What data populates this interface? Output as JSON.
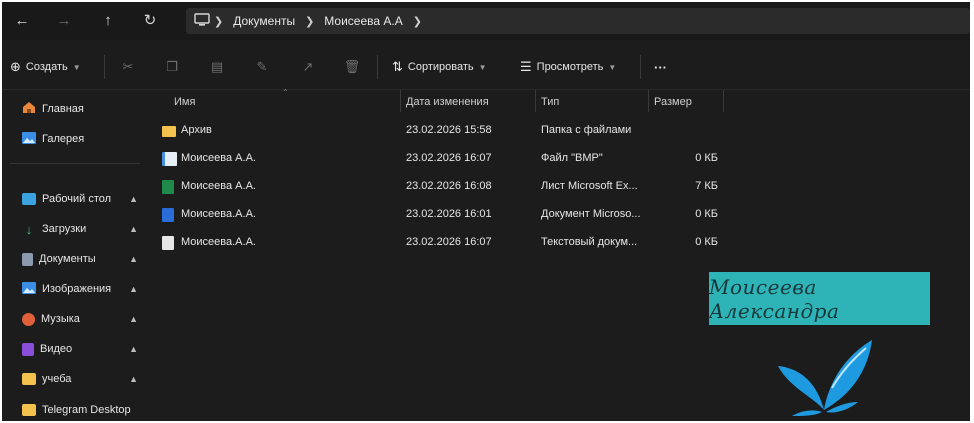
{
  "nav": {
    "back_icon": "arrow-left-icon",
    "forward_icon": "arrow-right-icon",
    "up_icon": "arrow-up-icon",
    "refresh_icon": "refresh-icon"
  },
  "breadcrumb": {
    "root_icon": "computer-icon",
    "items": [
      "Документы",
      "Моисеева А.А"
    ]
  },
  "toolbar": {
    "create": "Создать",
    "sort": "Сортировать",
    "view": "Просмотреть",
    "more": "···"
  },
  "sidebar": {
    "pinned": [
      {
        "label": "Главная",
        "icon": "home-icon",
        "color": "#e8873a"
      },
      {
        "label": "Галерея",
        "icon": "gallery-icon",
        "color": "#3a8ee6"
      }
    ],
    "quick": [
      {
        "label": "Рабочий стол",
        "icon": "desktop-icon",
        "color": "#3ba4e0",
        "pin": "📌"
      },
      {
        "label": "Загрузки",
        "icon": "download-icon",
        "color": "#3fbf7a",
        "pin": "📌"
      },
      {
        "label": "Документы",
        "icon": "documents-icon",
        "color": "#8c9ab0",
        "pin": "📌"
      },
      {
        "label": "Изображения",
        "icon": "pictures-icon",
        "color": "#3a8ee6",
        "pin": "📌"
      },
      {
        "label": "Музыка",
        "icon": "music-icon",
        "color": "#e0603a",
        "pin": "📌"
      },
      {
        "label": "Видео",
        "icon": "video-icon",
        "color": "#8a4fd8",
        "pin": "📌"
      },
      {
        "label": "учеба",
        "icon": "folder-icon",
        "color": "#f2c14e",
        "pin": "📌"
      },
      {
        "label": "Telegram Desktop",
        "icon": "folder-icon",
        "color": "#f2c14e",
        "pin": ""
      }
    ]
  },
  "columns": {
    "name": "Имя",
    "date": "Дата изменения",
    "type": "Тип",
    "size": "Размер"
  },
  "files": [
    {
      "name": "Архив",
      "date": "23.02.2026 15:58",
      "type": "Папка с файлами",
      "size": "",
      "icon": "folder-icon",
      "color": "#f2c14e"
    },
    {
      "name": "Моисеева А.А.",
      "date": "23.02.2026 16:07",
      "type": "Файл \"BMP\"",
      "size": "0 КБ",
      "icon": "image-file-icon",
      "color": "#4b8fe0"
    },
    {
      "name": "Моисеева А.А.",
      "date": "23.02.2026 16:08",
      "type": "Лист Microsoft Ex...",
      "size": "7 КБ",
      "icon": "excel-file-icon",
      "color": "#1f8a4c"
    },
    {
      "name": "Моисеева.А.А.",
      "date": "23.02.2026 16:01",
      "type": "Документ Microso...",
      "size": "0 КБ",
      "icon": "word-file-icon",
      "color": "#2b6cd6"
    },
    {
      "name": "Моисеева.А.А.",
      "date": "23.02.2026 16:07",
      "type": "Текстовый докум...",
      "size": "0 КБ",
      "icon": "text-file-icon",
      "color": "#e6e6e6"
    }
  ],
  "overlay": {
    "signature": "Моисеева Александра",
    "signature_bg": "#2eb3b7",
    "butterfly_color": "#1e9be0"
  }
}
